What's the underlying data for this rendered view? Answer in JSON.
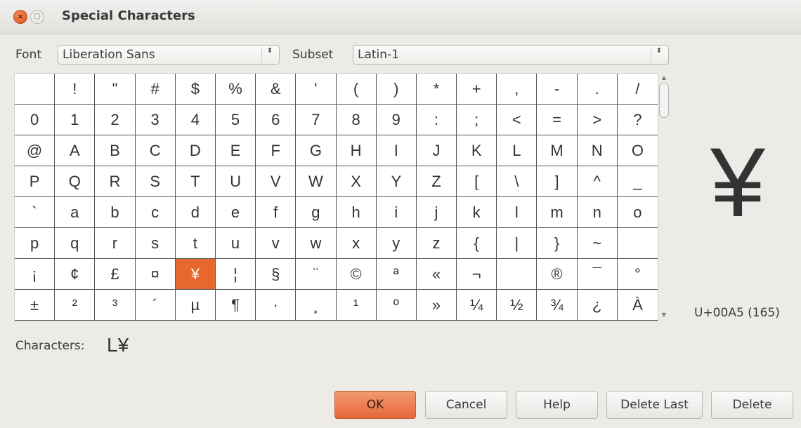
{
  "window": {
    "title": "Special Characters",
    "close_glyph": "×",
    "maximize_glyph": "□"
  },
  "font": {
    "label": "Font",
    "value": "Liberation Sans"
  },
  "subset": {
    "label": "Subset",
    "value": "Latin-1"
  },
  "combo_arrow": "⬍",
  "grid": {
    "rows": [
      [
        "",
        "!",
        "\"",
        "#",
        "$",
        "%",
        "&",
        "'",
        "(",
        ")",
        "*",
        "+",
        ",",
        "-",
        ".",
        "/"
      ],
      [
        "0",
        "1",
        "2",
        "3",
        "4",
        "5",
        "6",
        "7",
        "8",
        "9",
        ":",
        ";",
        "<",
        "=",
        ">",
        "?"
      ],
      [
        "@",
        "A",
        "B",
        "C",
        "D",
        "E",
        "F",
        "G",
        "H",
        "I",
        "J",
        "K",
        "L",
        "M",
        "N",
        "O"
      ],
      [
        "P",
        "Q",
        "R",
        "S",
        "T",
        "U",
        "V",
        "W",
        "X",
        "Y",
        "Z",
        "[",
        "\\",
        "]",
        "^",
        "_"
      ],
      [
        "`",
        "a",
        "b",
        "c",
        "d",
        "e",
        "f",
        "g",
        "h",
        "i",
        "j",
        "k",
        "l",
        "m",
        "n",
        "o"
      ],
      [
        "p",
        "q",
        "r",
        "s",
        "t",
        "u",
        "v",
        "w",
        "x",
        "y",
        "z",
        "{",
        "|",
        "}",
        "~",
        ""
      ],
      [
        "¡",
        "¢",
        "£",
        "¤",
        "¥",
        "¦",
        "§",
        "¨",
        "©",
        "ª",
        "«",
        "¬",
        "",
        "®",
        "¯",
        "°"
      ],
      [
        "±",
        "²",
        "³",
        "´",
        "µ",
        "¶",
        "·",
        "¸",
        "¹",
        "º",
        "»",
        "¼",
        "½",
        "¾",
        "¿",
        "À"
      ]
    ],
    "selected_row": 6,
    "selected_col": 4,
    "selected_color": "#e8672f"
  },
  "preview": {
    "glyph": "¥",
    "code": "U+00A5 (165)"
  },
  "characters": {
    "label": "Characters:",
    "value": "L¥"
  },
  "buttons": {
    "ok": "OK",
    "cancel": "Cancel",
    "help": "Help",
    "delete_last": "Delete Last",
    "delete": "Delete"
  }
}
